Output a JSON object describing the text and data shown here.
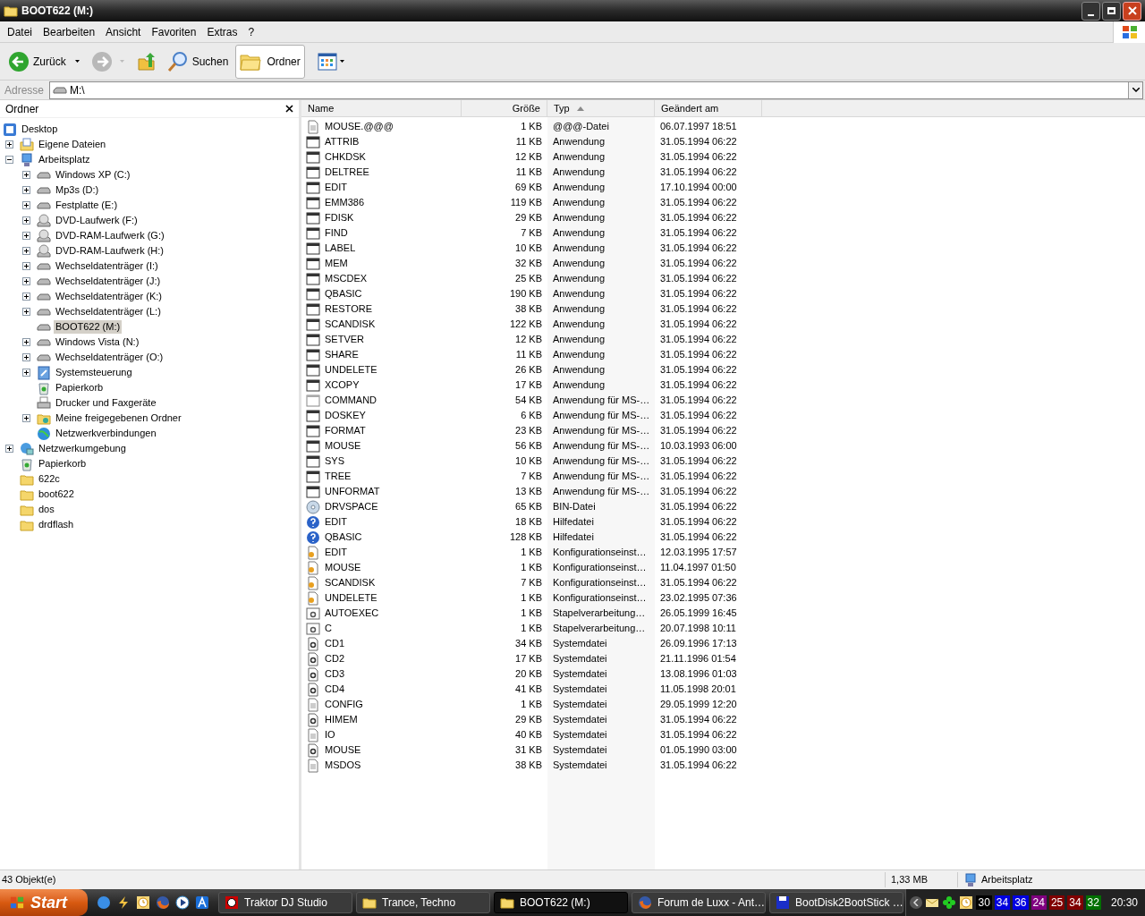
{
  "window": {
    "title": "BOOT622 (M:)"
  },
  "menu": [
    "Datei",
    "Bearbeiten",
    "Ansicht",
    "Favoriten",
    "Extras",
    "?"
  ],
  "toolbar": {
    "back": {
      "label": "Zurück",
      "disabled": false
    },
    "forward": {
      "disabled": true
    },
    "search": {
      "label": "Suchen"
    },
    "folders": {
      "label": "Ordner",
      "selected": true
    }
  },
  "address": {
    "label": "Adresse",
    "value": "M:\\"
  },
  "tree": {
    "title": "Ordner",
    "items": [
      {
        "label": "Desktop",
        "kind": "desktop",
        "selected": false,
        "children": [
          {
            "label": "Eigene Dateien",
            "kind": "documents",
            "selected": false,
            "expanded": false
          },
          {
            "label": "Arbeitsplatz",
            "kind": "computer",
            "selected": false,
            "expanded": true,
            "children": [
              {
                "label": "Windows XP (C:)",
                "kind": "drive",
                "selected": false,
                "expanded": false
              },
              {
                "label": "Mp3s (D:)",
                "kind": "drive",
                "selected": false,
                "expanded": false
              },
              {
                "label": "Festplatte (E:)",
                "kind": "drive",
                "selected": false,
                "expanded": false
              },
              {
                "label": "DVD-Laufwerk (F:)",
                "kind": "dvd",
                "selected": false,
                "expanded": false
              },
              {
                "label": "DVD-RAM-Laufwerk (G:)",
                "kind": "dvd",
                "selected": false,
                "expanded": false
              },
              {
                "label": "DVD-RAM-Laufwerk (H:)",
                "kind": "dvd",
                "selected": false,
                "expanded": false
              },
              {
                "label": "Wechseldatenträger (I:)",
                "kind": "drive",
                "selected": false,
                "expanded": false
              },
              {
                "label": "Wechseldatenträger (J:)",
                "kind": "drive",
                "selected": false,
                "expanded": false
              },
              {
                "label": "Wechseldatenträger (K:)",
                "kind": "drive",
                "selected": false,
                "expanded": false
              },
              {
                "label": "Wechseldatenträger (L:)",
                "kind": "drive",
                "selected": false,
                "expanded": false
              },
              {
                "label": "BOOT622 (M:)",
                "kind": "drive",
                "selected": true
              },
              {
                "label": "Windows Vista (N:)",
                "kind": "drive",
                "selected": false,
                "expanded": false
              },
              {
                "label": "Wechseldatenträger (O:)",
                "kind": "drive",
                "selected": false,
                "expanded": false
              },
              {
                "label": "Systemsteuerung",
                "kind": "control",
                "selected": false,
                "expanded": false
              },
              {
                "label": "Papierkorb",
                "kind": "recycle",
                "selected": false
              },
              {
                "label": "Drucker und Faxgeräte",
                "kind": "printer",
                "selected": false
              },
              {
                "label": "Meine freigegebenen Ordner",
                "kind": "shared",
                "selected": false,
                "expanded": false
              },
              {
                "label": "Netzwerkverbindungen",
                "kind": "network",
                "selected": false
              }
            ]
          },
          {
            "label": "Netzwerkumgebung",
            "kind": "netenv",
            "selected": false,
            "expanded": false
          },
          {
            "label": "Papierkorb",
            "kind": "recycle",
            "selected": false
          },
          {
            "label": "622c",
            "kind": "folder",
            "selected": false
          },
          {
            "label": "boot622",
            "kind": "folder",
            "selected": false
          },
          {
            "label": "dos",
            "kind": "folder",
            "selected": false
          },
          {
            "label": "drdflash",
            "kind": "folder",
            "selected": false
          }
        ]
      }
    ]
  },
  "columns": [
    {
      "label": "Name",
      "sorted": false
    },
    {
      "label": "Größe",
      "sorted": false
    },
    {
      "label": "Typ",
      "sorted": true
    },
    {
      "label": "Geändert am",
      "sorted": false
    }
  ],
  "files": [
    {
      "name": "MOUSE.@@@",
      "size": "1 KB",
      "type": "@@@-Datei",
      "date": "06.07.1997 18:51",
      "kind": "doc"
    },
    {
      "name": "ATTRIB",
      "size": "11 KB",
      "type": "Anwendung",
      "date": "31.05.1994 06:22",
      "kind": "app"
    },
    {
      "name": "CHKDSK",
      "size": "12 KB",
      "type": "Anwendung",
      "date": "31.05.1994 06:22",
      "kind": "app"
    },
    {
      "name": "DELTREE",
      "size": "11 KB",
      "type": "Anwendung",
      "date": "31.05.1994 06:22",
      "kind": "app"
    },
    {
      "name": "EDIT",
      "size": "69 KB",
      "type": "Anwendung",
      "date": "17.10.1994 00:00",
      "kind": "app"
    },
    {
      "name": "EMM386",
      "size": "119 KB",
      "type": "Anwendung",
      "date": "31.05.1994 06:22",
      "kind": "app"
    },
    {
      "name": "FDISK",
      "size": "29 KB",
      "type": "Anwendung",
      "date": "31.05.1994 06:22",
      "kind": "app"
    },
    {
      "name": "FIND",
      "size": "7 KB",
      "type": "Anwendung",
      "date": "31.05.1994 06:22",
      "kind": "app"
    },
    {
      "name": "LABEL",
      "size": "10 KB",
      "type": "Anwendung",
      "date": "31.05.1994 06:22",
      "kind": "app"
    },
    {
      "name": "MEM",
      "size": "32 KB",
      "type": "Anwendung",
      "date": "31.05.1994 06:22",
      "kind": "app"
    },
    {
      "name": "MSCDEX",
      "size": "25 KB",
      "type": "Anwendung",
      "date": "31.05.1994 06:22",
      "kind": "app"
    },
    {
      "name": "QBASIC",
      "size": "190 KB",
      "type": "Anwendung",
      "date": "31.05.1994 06:22",
      "kind": "app"
    },
    {
      "name": "RESTORE",
      "size": "38 KB",
      "type": "Anwendung",
      "date": "31.05.1994 06:22",
      "kind": "app"
    },
    {
      "name": "SCANDISK",
      "size": "122 KB",
      "type": "Anwendung",
      "date": "31.05.1994 06:22",
      "kind": "app"
    },
    {
      "name": "SETVER",
      "size": "12 KB",
      "type": "Anwendung",
      "date": "31.05.1994 06:22",
      "kind": "app"
    },
    {
      "name": "SHARE",
      "size": "11 KB",
      "type": "Anwendung",
      "date": "31.05.1994 06:22",
      "kind": "app"
    },
    {
      "name": "UNDELETE",
      "size": "26 KB",
      "type": "Anwendung",
      "date": "31.05.1994 06:22",
      "kind": "app"
    },
    {
      "name": "XCOPY",
      "size": "17 KB",
      "type": "Anwendung",
      "date": "31.05.1994 06:22",
      "kind": "app"
    },
    {
      "name": "COMMAND",
      "size": "54 KB",
      "type": "Anwendung für MS-…",
      "date": "31.05.1994 06:22",
      "kind": "dos"
    },
    {
      "name": "DOSKEY",
      "size": "6 KB",
      "type": "Anwendung für MS-…",
      "date": "31.05.1994 06:22",
      "kind": "app"
    },
    {
      "name": "FORMAT",
      "size": "23 KB",
      "type": "Anwendung für MS-…",
      "date": "31.05.1994 06:22",
      "kind": "app"
    },
    {
      "name": "MOUSE",
      "size": "56 KB",
      "type": "Anwendung für MS-…",
      "date": "10.03.1993 06:00",
      "kind": "app"
    },
    {
      "name": "SYS",
      "size": "10 KB",
      "type": "Anwendung für MS-…",
      "date": "31.05.1994 06:22",
      "kind": "app"
    },
    {
      "name": "TREE",
      "size": "7 KB",
      "type": "Anwendung für MS-…",
      "date": "31.05.1994 06:22",
      "kind": "app"
    },
    {
      "name": "UNFORMAT",
      "size": "13 KB",
      "type": "Anwendung für MS-…",
      "date": "31.05.1994 06:22",
      "kind": "app"
    },
    {
      "name": "DRVSPACE",
      "size": "65 KB",
      "type": "BIN-Datei",
      "date": "31.05.1994 06:22",
      "kind": "bin"
    },
    {
      "name": "EDIT",
      "size": "18 KB",
      "type": "Hilfedatei",
      "date": "31.05.1994 06:22",
      "kind": "help"
    },
    {
      "name": "QBASIC",
      "size": "128 KB",
      "type": "Hilfedatei",
      "date": "31.05.1994 06:22",
      "kind": "help"
    },
    {
      "name": "EDIT",
      "size": "1 KB",
      "type": "Konfigurationseinst…",
      "date": "12.03.1995 17:57",
      "kind": "ini"
    },
    {
      "name": "MOUSE",
      "size": "1 KB",
      "type": "Konfigurationseinst…",
      "date": "11.04.1997 01:50",
      "kind": "ini"
    },
    {
      "name": "SCANDISK",
      "size": "7 KB",
      "type": "Konfigurationseinst…",
      "date": "31.05.1994 06:22",
      "kind": "ini"
    },
    {
      "name": "UNDELETE",
      "size": "1 KB",
      "type": "Konfigurationseinst…",
      "date": "23.02.1995 07:36",
      "kind": "ini"
    },
    {
      "name": "AUTOEXEC",
      "size": "1 KB",
      "type": "Stapelverarbeitung…",
      "date": "26.05.1999 16:45",
      "kind": "bat"
    },
    {
      "name": "C",
      "size": "1 KB",
      "type": "Stapelverarbeitung…",
      "date": "20.07.1998 10:11",
      "kind": "bat"
    },
    {
      "name": "CD1",
      "size": "34 KB",
      "type": "Systemdatei",
      "date": "26.09.1996 17:13",
      "kind": "sys"
    },
    {
      "name": "CD2",
      "size": "17 KB",
      "type": "Systemdatei",
      "date": "21.11.1996 01:54",
      "kind": "sys"
    },
    {
      "name": "CD3",
      "size": "20 KB",
      "type": "Systemdatei",
      "date": "13.08.1996 01:03",
      "kind": "sys"
    },
    {
      "name": "CD4",
      "size": "41 KB",
      "type": "Systemdatei",
      "date": "11.05.1998 20:01",
      "kind": "sys"
    },
    {
      "name": "CONFIG",
      "size": "1 KB",
      "type": "Systemdatei",
      "date": "29.05.1999 12:20",
      "kind": "doc"
    },
    {
      "name": "HIMEM",
      "size": "29 KB",
      "type": "Systemdatei",
      "date": "31.05.1994 06:22",
      "kind": "sys"
    },
    {
      "name": "IO",
      "size": "40 KB",
      "type": "Systemdatei",
      "date": "31.05.1994 06:22",
      "kind": "doc"
    },
    {
      "name": "MOUSE",
      "size": "31 KB",
      "type": "Systemdatei",
      "date": "01.05.1990 03:00",
      "kind": "sys"
    },
    {
      "name": "MSDOS",
      "size": "38 KB",
      "type": "Systemdatei",
      "date": "31.05.1994 06:22",
      "kind": "doc"
    }
  ],
  "status_bar": {
    "count": "43 Objekt(e)",
    "size": "1,33 MB",
    "location": "Arbeitsplatz"
  },
  "taskbar": {
    "start": "Start",
    "quick_launch": [
      {
        "kind": "ie"
      },
      {
        "kind": "bolt"
      },
      {
        "kind": "clock"
      },
      {
        "kind": "firefox"
      },
      {
        "kind": "player"
      },
      {
        "kind": "a"
      }
    ],
    "tasks": [
      {
        "label": "Traktor DJ Studio",
        "kind": "traktor",
        "selected": false
      },
      {
        "label": "Trance, Techno",
        "kind": "folder",
        "selected": false
      },
      {
        "label": "BOOT622 (M:)",
        "kind": "folder",
        "selected": true
      },
      {
        "label": "Forum de Luxx - Ant…",
        "kind": "firefox",
        "selected": false
      },
      {
        "label": "BootDisk2BootStick …",
        "kind": "floppy",
        "selected": false
      }
    ],
    "tray_numbers": [
      {
        "text": "30",
        "color": "#000000"
      },
      {
        "text": "34",
        "color": "#0000e0"
      },
      {
        "text": "36",
        "color": "#0000e0"
      },
      {
        "text": "24",
        "color": "#800080"
      },
      {
        "text": "25",
        "color": "#800000"
      },
      {
        "text": "34",
        "color": "#800000"
      },
      {
        "text": "32",
        "color": "#007000"
      }
    ],
    "clock": "20:30"
  }
}
